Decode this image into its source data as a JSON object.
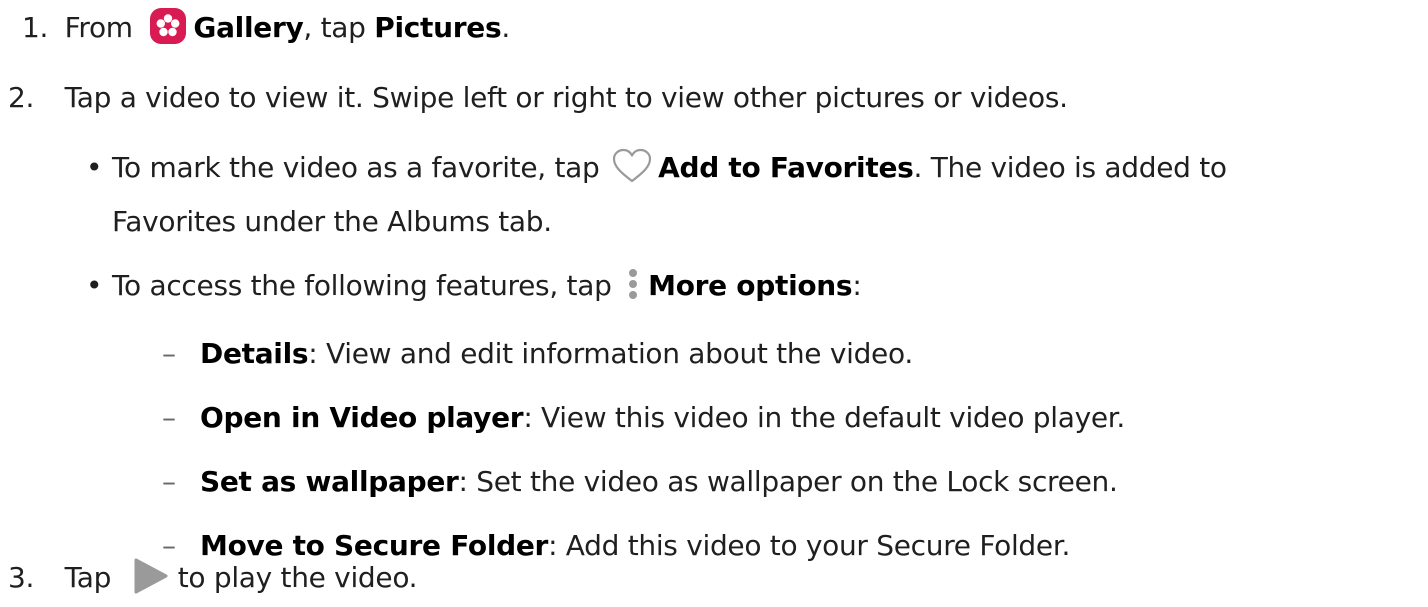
{
  "steps": {
    "s1": {
      "num": "1.",
      "t1": "From",
      "gallery": "Gallery",
      "t2": ", tap ",
      "pictures": "Pictures",
      "t3": "."
    },
    "s2": {
      "num": "2.",
      "text": "Tap a video to view it. Swipe left or right to view other pictures or videos."
    },
    "b1": {
      "t1": "To mark the video as a favorite, tap",
      "bold": "Add to Favorites",
      "t2": ". The video is added to",
      "cont": "Favorites under the Albums tab."
    },
    "b2": {
      "t1": "To access the following features, tap",
      "bold": "More options",
      "t2": ":"
    },
    "sub": [
      {
        "bold": "Details",
        "text": ": View and edit information about the video."
      },
      {
        "bold": "Open in Video player",
        "text": ": View this video in the default video player."
      },
      {
        "bold": "Set as wallpaper",
        "text": ": Set the video as wallpaper on the Lock screen."
      },
      {
        "bold": "Move to Secure Folder",
        "text": ": Add this video to your Secure Folder."
      }
    ],
    "s3": {
      "num": "3.",
      "t1": "Tap",
      "t2": "to play the video."
    }
  },
  "bullet_char": "•",
  "dash_char": "–",
  "icons": {
    "gallery": {
      "name": "gallery-icon",
      "color": "#d81b52"
    },
    "heart": {
      "name": "heart-icon",
      "color": "#9a9a9a"
    },
    "more": {
      "name": "more-options-icon",
      "color": "#9a9a9a"
    },
    "play": {
      "name": "play-icon",
      "color": "#9a9a9a"
    }
  }
}
